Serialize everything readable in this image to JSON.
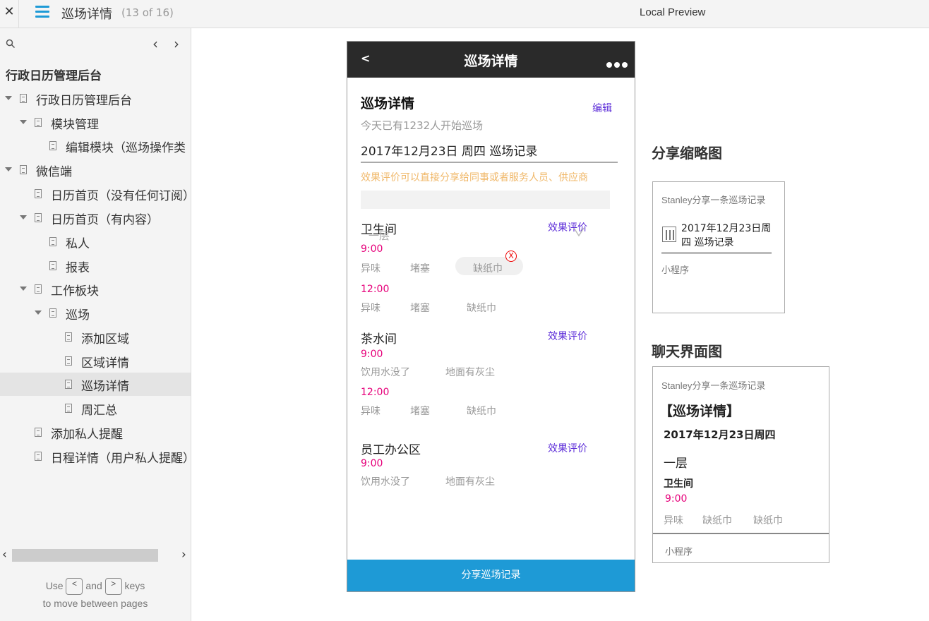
{
  "topbar": {
    "close_glyph": "✕",
    "page_title": "巡场详情",
    "page_count": "(13 of 16)",
    "preview_label": "Local Preview"
  },
  "sidebar": {
    "root_title": "行政日历管理后台",
    "items": [
      {
        "label": "行政日历管理后台",
        "expanded": true
      },
      {
        "label": "模块管理",
        "expanded": true
      },
      {
        "label": "编辑模块（巡场操作类"
      },
      {
        "label": "微信端",
        "expanded": true
      },
      {
        "label": "日历首页（没有任何订阅）"
      },
      {
        "label": "日历首页（有内容）",
        "expanded": true
      },
      {
        "label": "私人"
      },
      {
        "label": "报表"
      },
      {
        "label": "工作板块",
        "expanded": true
      },
      {
        "label": "巡场",
        "expanded": true
      },
      {
        "label": "添加区域"
      },
      {
        "label": "区域详情"
      },
      {
        "label": "巡场详情",
        "active": true
      },
      {
        "label": "周汇总"
      },
      {
        "label": "添加私人提醒"
      },
      {
        "label": "日程详情（用户私人提醒）"
      }
    ],
    "hint_use": "Use",
    "hint_and": "and",
    "hint_keys": "keys",
    "hint_line2": "to move between pages",
    "key_prev": "<",
    "key_next": ">"
  },
  "phone": {
    "header": {
      "back": "<",
      "title": "巡场详情"
    },
    "title": "巡场详情",
    "edit": "编辑",
    "subnote": "今天已有1232人开始巡场",
    "date_line": "2017年12月23日 周四 巡场记录",
    "orange_note": "效果评价可以直接分享给同事或者服务人员、供应商",
    "eval_label": "效果评价",
    "areas": [
      {
        "name": "卫生间",
        "overlay": "一层",
        "checks": [
          {
            "time": "9:00",
            "tags": [
              "异味",
              "堵塞",
              "缺纸巾"
            ]
          },
          {
            "time": "12:00",
            "tags": [
              "异味",
              "堵塞",
              "缺纸巾"
            ]
          }
        ]
      },
      {
        "name": "茶水间",
        "checks": [
          {
            "time": "9:00",
            "tags": [
              "饮用水没了",
              "地面有灰尘"
            ]
          },
          {
            "time": "12:00",
            "tags": [
              "异味",
              "堵塞",
              "缺纸巾"
            ]
          }
        ]
      },
      {
        "name": "员工办公区",
        "checks": [
          {
            "time": "9:00",
            "tags": [
              "饮用水没了",
              "地面有灰尘"
            ]
          }
        ]
      }
    ],
    "delete_glyph": "X",
    "share_button": "分享巡场记录"
  },
  "thumbnail": {
    "section_title": "分享缩略图",
    "sender": "Stanley分享一条巡场记录",
    "record_line1": "2017年12月23日周",
    "record_line2": "四 巡场记录",
    "footer": "小程序"
  },
  "chat": {
    "section_title": "聊天界面图",
    "sender": "Stanley分享一条巡场记录",
    "heading": "【巡场详情】",
    "date": "2017年12月23日周四",
    "floor": "一层",
    "area": "卫生间",
    "time": "9:00",
    "tags": [
      "异味",
      "缺纸巾",
      "缺纸巾"
    ],
    "footer": "小程序"
  },
  "colors": {
    "accent_blue": "#1e9ad6",
    "link_purple": "#5b2bd8",
    "time_pink": "#e6007a",
    "note_orange": "#f0b86a"
  }
}
